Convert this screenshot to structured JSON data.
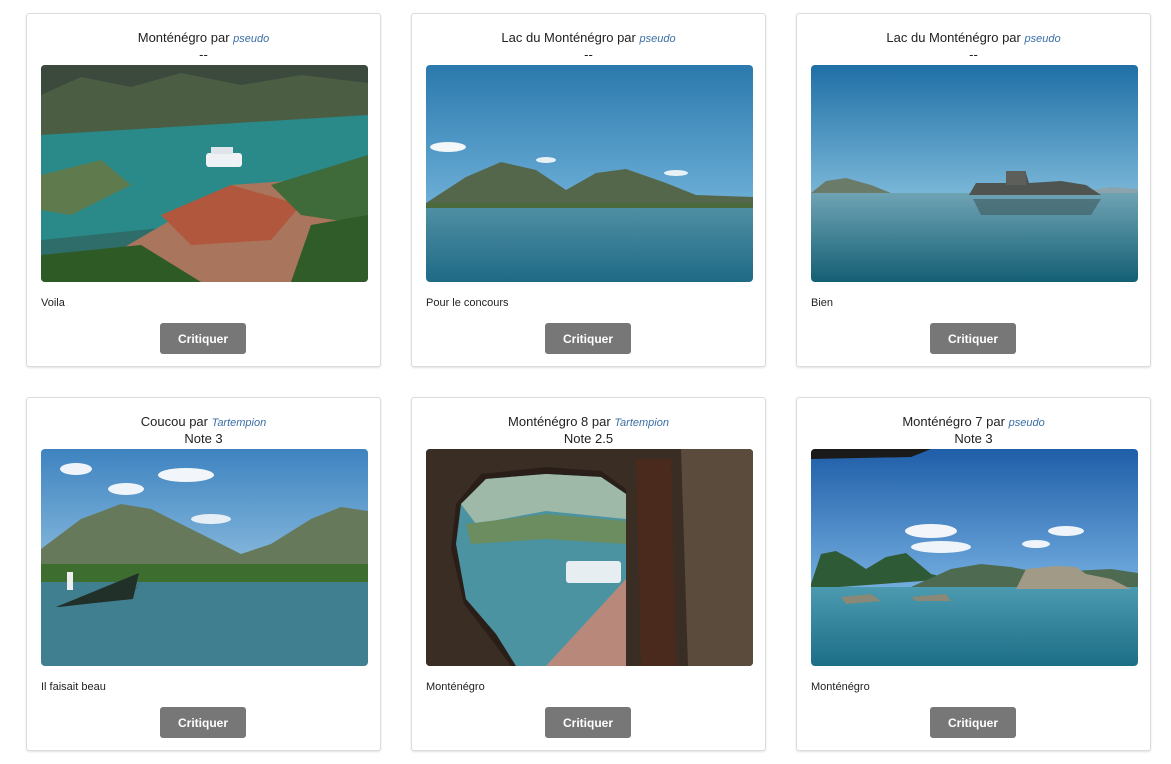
{
  "cards": [
    {
      "title": "Monténégro",
      "par": "par",
      "author": "pseudo",
      "note": "--",
      "caption": "Voila",
      "button": "Critiquer"
    },
    {
      "title": "Lac du Monténégro",
      "par": "par",
      "author": "pseudo",
      "note": "--",
      "caption": "Pour le concours",
      "button": "Critiquer"
    },
    {
      "title": "Lac du Monténégro",
      "par": "par",
      "author": "pseudo",
      "note": "--",
      "caption": "Bien",
      "button": "Critiquer"
    },
    {
      "title": "Coucou",
      "par": "par",
      "author": "Tartempion",
      "note": "Note 3",
      "caption": "Il faisait beau",
      "button": "Critiquer"
    },
    {
      "title": "Monténégro 8",
      "par": "par",
      "author": "Tartempion",
      "note": "Note 2.5",
      "caption": "Monténégro",
      "button": "Critiquer"
    },
    {
      "title": "Monténégro 7",
      "par": "par",
      "author": "pseudo",
      "note": "Note 3",
      "caption": "Monténégro",
      "button": "Critiquer"
    }
  ],
  "colors": {
    "author_link": "#3a6ea5",
    "button_bg": "#777777",
    "card_border": "#dcdcdc"
  }
}
